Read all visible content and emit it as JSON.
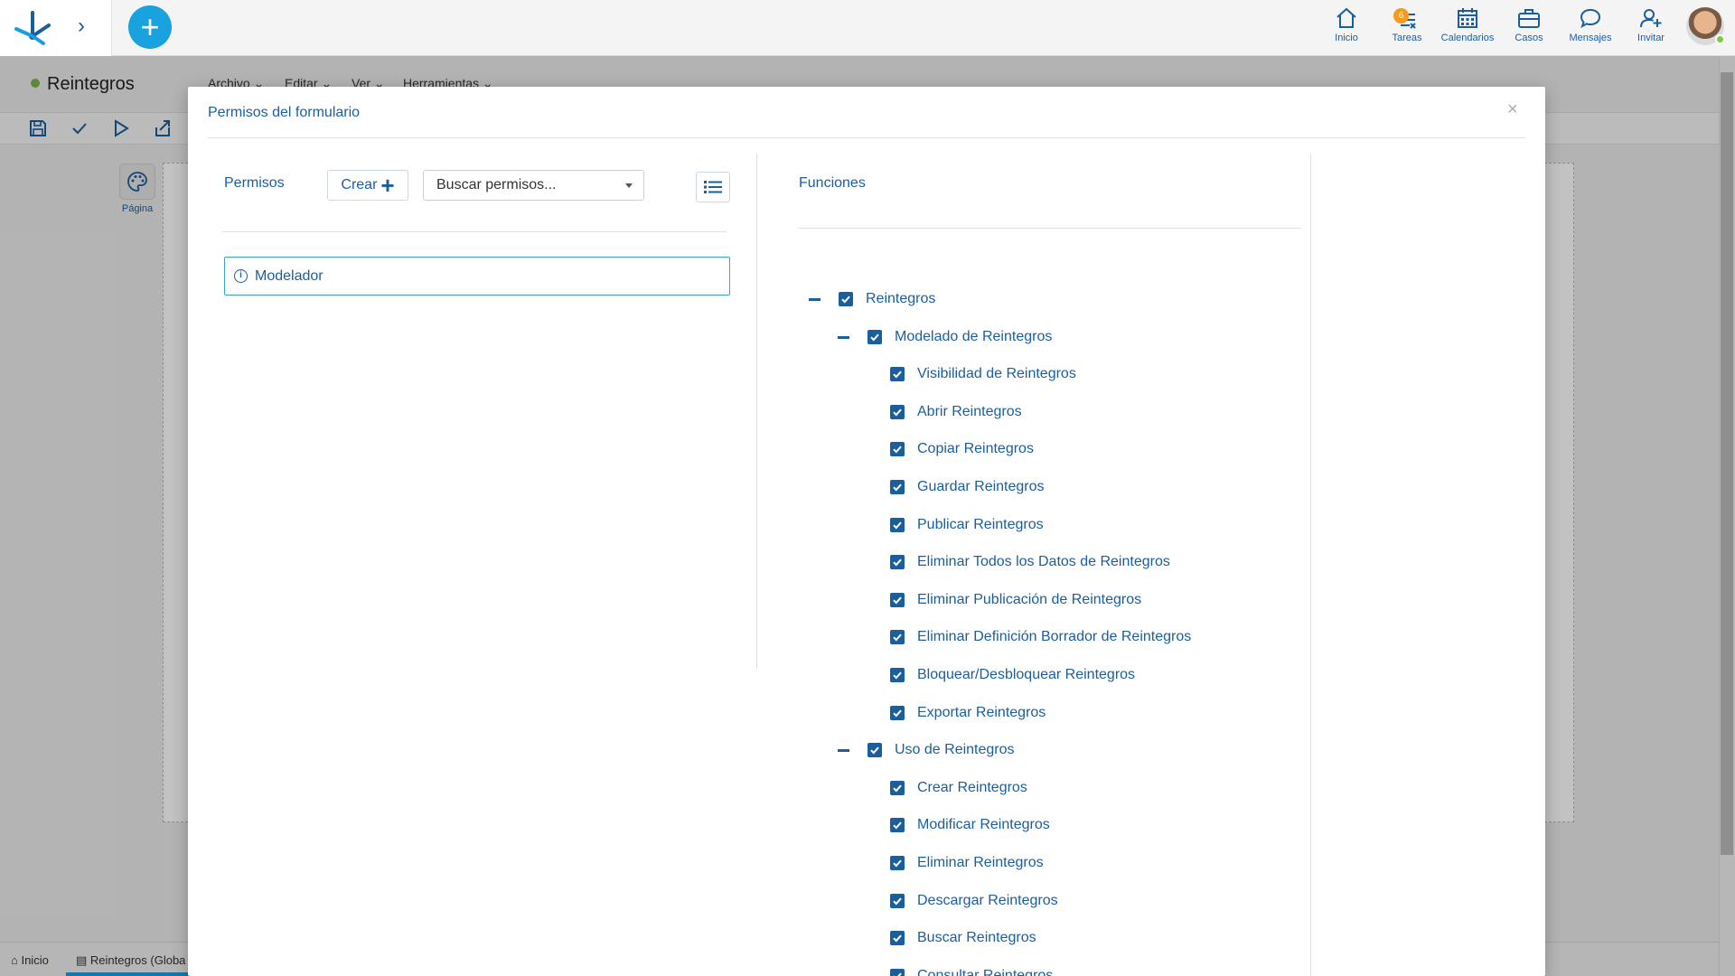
{
  "topbar": {
    "nav": [
      {
        "label": "Inicio",
        "icon": "home-icon"
      },
      {
        "label": "Tareas",
        "icon": "tasks-icon",
        "badge": "6"
      },
      {
        "label": "Calendarios",
        "icon": "calendar-icon"
      },
      {
        "label": "Casos",
        "icon": "briefcase-icon"
      },
      {
        "label": "Mensajes",
        "icon": "chat-icon"
      },
      {
        "label": "Invitar",
        "icon": "invite-user-icon"
      }
    ]
  },
  "app": {
    "title": "Reintegros",
    "menu": [
      "Archivo",
      "Editar",
      "Ver",
      "Herramientas"
    ],
    "page_label": "Página"
  },
  "bottom_tabs": {
    "home": "Inicio",
    "current": "Reintegros (Globa"
  },
  "modal": {
    "title": "Permisos del formulario",
    "close": "×",
    "permissions": {
      "label": "Permisos",
      "create_label": "Crear",
      "search_value": "Buscar permisos...",
      "roles": [
        "Modelador"
      ]
    },
    "functions": {
      "label": "Funciones",
      "tree": [
        {
          "label": "Reintegros",
          "level": 0,
          "expanded": true,
          "checked": true
        },
        {
          "label": "Modelado de Reintegros",
          "level": 1,
          "expanded": true,
          "checked": true
        },
        {
          "label": "Visibilidad de Reintegros",
          "level": 2,
          "checked": true
        },
        {
          "label": "Abrir Reintegros",
          "level": 2,
          "checked": true
        },
        {
          "label": "Copiar Reintegros",
          "level": 2,
          "checked": true
        },
        {
          "label": "Guardar Reintegros",
          "level": 2,
          "checked": true
        },
        {
          "label": "Publicar Reintegros",
          "level": 2,
          "checked": true
        },
        {
          "label": "Eliminar Todos los Datos de Reintegros",
          "level": 2,
          "checked": true
        },
        {
          "label": "Eliminar Publicación de Reintegros",
          "level": 2,
          "checked": true
        },
        {
          "label": "Eliminar Definición Borrador de Reintegros",
          "level": 2,
          "checked": true
        },
        {
          "label": "Bloquear/Desbloquear Reintegros",
          "level": 2,
          "checked": true
        },
        {
          "label": "Exportar Reintegros",
          "level": 2,
          "checked": true
        },
        {
          "label": "Uso de Reintegros",
          "level": 1,
          "expanded": true,
          "checked": true
        },
        {
          "label": "Crear Reintegros",
          "level": 2,
          "checked": true
        },
        {
          "label": "Modificar Reintegros",
          "level": 2,
          "checked": true
        },
        {
          "label": "Eliminar Reintegros",
          "level": 2,
          "checked": true
        },
        {
          "label": "Descargar Reintegros",
          "level": 2,
          "checked": true
        },
        {
          "label": "Buscar Reintegros",
          "level": 2,
          "checked": true
        },
        {
          "label": "Consultar Reintegros",
          "level": 2,
          "checked": true
        }
      ]
    }
  },
  "colors": {
    "accent": "#1a5e9e",
    "add_button": "#19a2de",
    "badge": "#f59b1c",
    "status_dot": "#7ab44a",
    "role_border": "#3aa6c0"
  }
}
